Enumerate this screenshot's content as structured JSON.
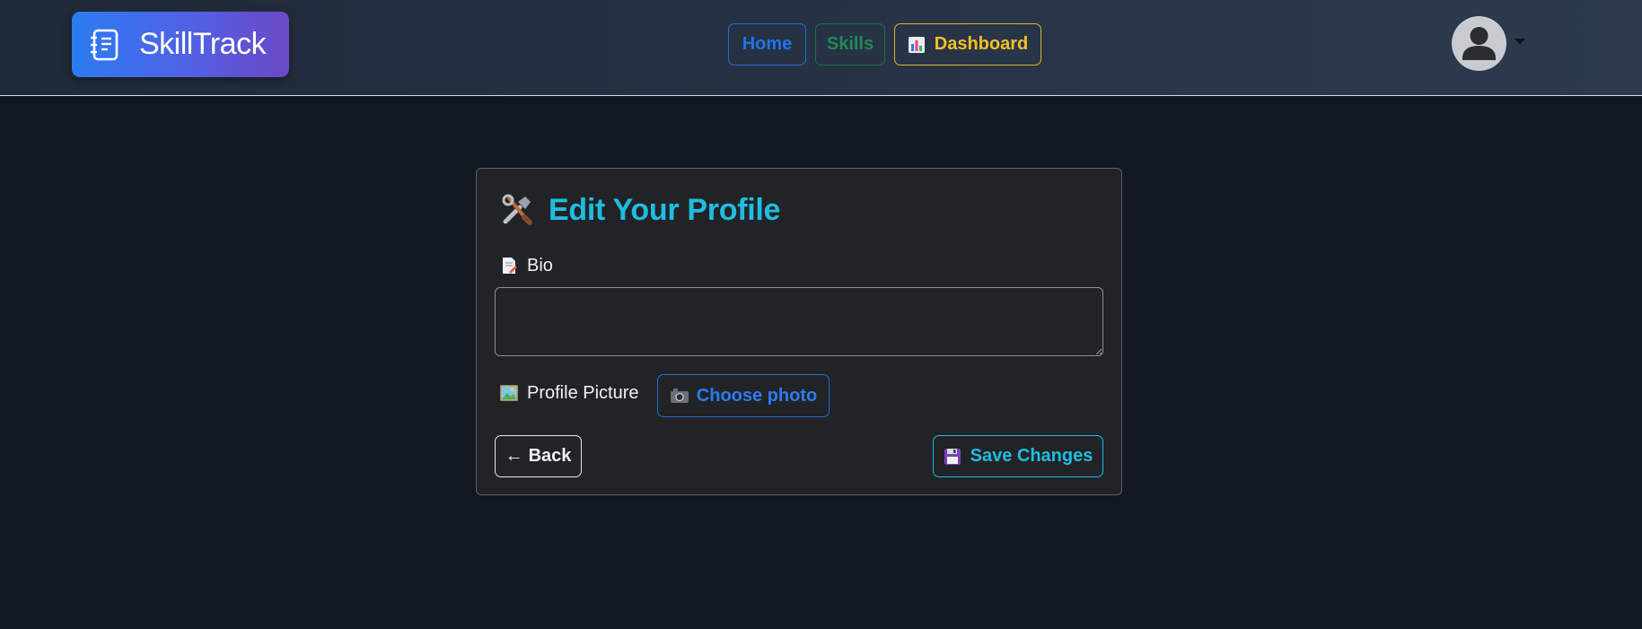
{
  "brand": {
    "name": "SkillTrack",
    "icon": "notebook-icon"
  },
  "nav": {
    "home_label": "Home",
    "skills_label": "Skills",
    "dashboard_label": "Dashboard",
    "dashboard_icon": "bar-chart-icon"
  },
  "user_menu": {
    "avatar_icon": "user-avatar-icon",
    "caret_icon": "caret-down-icon"
  },
  "form": {
    "title": "Edit Your Profile",
    "title_icon": "tools-icon",
    "bio_label": "Bio",
    "bio_icon": "memo-icon",
    "bio_value": "",
    "picture_label": "Profile Picture",
    "picture_icon": "framed-picture-icon",
    "choose_label": "Choose photo",
    "choose_icon": "camera-icon",
    "back_label": "Back",
    "back_arrow": "←",
    "save_label": "Save Changes",
    "save_icon": "floppy-disk-icon"
  },
  "colors": {
    "page_bg": "#111821",
    "card_bg": "#212327",
    "accent_cyan": "#1fbde0",
    "primary_blue": "#1f73e8",
    "success_green": "#1f8a55",
    "warning_yellow": "#f5c026"
  }
}
